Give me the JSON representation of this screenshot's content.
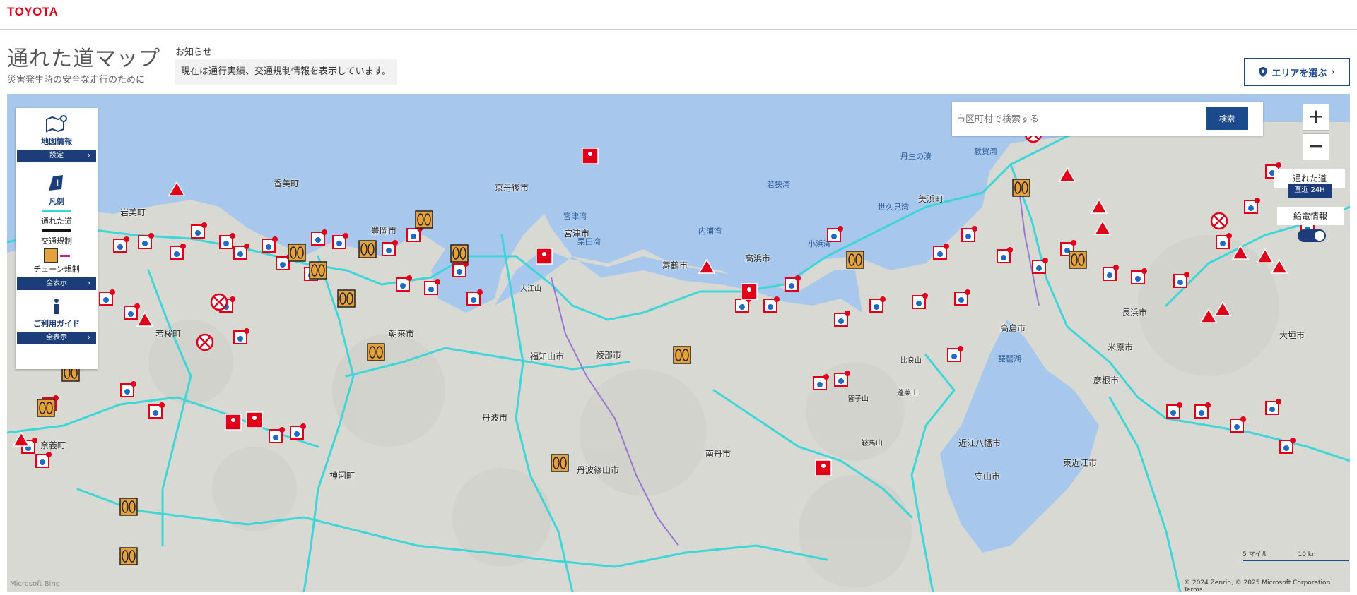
{
  "header": {
    "logo": "TOYOTA"
  },
  "page": {
    "title": "通れた道マップ",
    "subtitle": "災害発生時の安全な走行のために"
  },
  "notice": {
    "title": "お知らせ",
    "text": "現在は通行実績、交通規制情報を表示しています。"
  },
  "area_button": {
    "label": "エリアを選ぶ"
  },
  "legend": {
    "map_info": "地図情報",
    "settings_button": "設定",
    "hanrei": "凡例",
    "passable_road": "通れた道",
    "traffic_reg": "交通規制",
    "chain_reg": "チェーン規制",
    "show_all_1": "全表示",
    "guide": "ご利用ガイド",
    "show_all_2": "全表示"
  },
  "search": {
    "placeholder": "市区町村で検索する",
    "button": "検索"
  },
  "zoom": {
    "in": "+",
    "out": "−"
  },
  "layers": {
    "passable": "通れた道",
    "latest": "直近 24H",
    "power": "給電情報"
  },
  "place_labels": [
    "京丹後市",
    "宮津市",
    "舞鶴市",
    "高浜市",
    "美浜町",
    "香美町",
    "豊岡市",
    "朝来市",
    "福知山市",
    "綾部市",
    "丹波市",
    "南丹市",
    "丹波篠山市",
    "神河町",
    "高島市",
    "長浜市",
    "米原市",
    "彦根市",
    "東近江市",
    "近江八幡市",
    "大垣市",
    "若桜町",
    "奈義町",
    "岩美町",
    "守山市",
    "大江山",
    "蓬莱山",
    "比良山",
    "鞍馬山",
    "皆子山"
  ],
  "water_labels": [
    "若狭湾",
    "宮津湾",
    "栗田湾",
    "内浦湾",
    "小浜湾",
    "世久見湾",
    "敦賀湾",
    "丹生の湊",
    "琵琶湖"
  ],
  "footer": {
    "scale_miles": "5 マイル",
    "scale_km": "10 km",
    "attribution": "© 2024 Zenrin, © 2025 Microsoft Corporation  Terms",
    "bing": "Microsoft Bing"
  }
}
